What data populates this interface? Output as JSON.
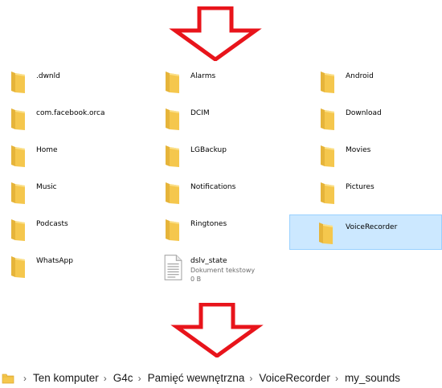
{
  "items": [
    {
      "label": ".dwnld",
      "type": "folder"
    },
    {
      "label": "Alarms",
      "type": "folder"
    },
    {
      "label": "Android",
      "type": "folder"
    },
    {
      "label": "com.facebook.orca",
      "type": "folder"
    },
    {
      "label": "DCIM",
      "type": "folder"
    },
    {
      "label": "Download",
      "type": "folder"
    },
    {
      "label": "Home",
      "type": "folder"
    },
    {
      "label": "LGBackup",
      "type": "folder"
    },
    {
      "label": "Movies",
      "type": "folder"
    },
    {
      "label": "Music",
      "type": "folder"
    },
    {
      "label": "Notifications",
      "type": "folder"
    },
    {
      "label": "Pictures",
      "type": "folder"
    },
    {
      "label": "Podcasts",
      "type": "folder"
    },
    {
      "label": "Ringtones",
      "type": "folder"
    },
    {
      "label": "VoiceRecorder",
      "type": "folder",
      "selected": true
    },
    {
      "label": "WhatsApp",
      "type": "folder"
    },
    {
      "label": "dslv_state",
      "type": "file",
      "file_type": "Dokument tekstowy",
      "size": "0 B"
    }
  ],
  "breadcrumb": {
    "items": [
      "Ten komputer",
      "G4c",
      "Pamięć wewnętrzna",
      "VoiceRecorder",
      "my_sounds"
    ]
  },
  "colors": {
    "arrow": "#e8141b",
    "folder": "#f5c74d",
    "selection": "#cce8ff"
  },
  "icons": {
    "arrow": "down-arrow-outline-icon",
    "folder": "folder-icon",
    "file": "text-document-icon",
    "separator": "chevron-right-icon"
  }
}
